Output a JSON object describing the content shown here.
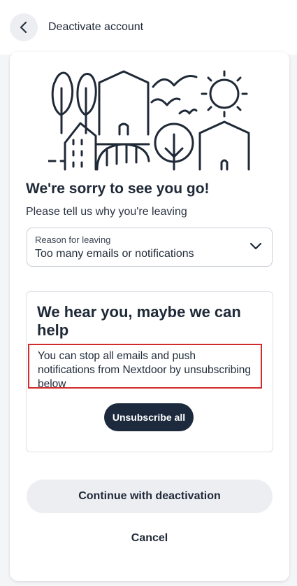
{
  "header": {
    "title": "Deactivate account",
    "back_icon": "chevron-left-icon"
  },
  "illustration": {
    "name": "village-illustration",
    "stroke_color": "#1f2937"
  },
  "main": {
    "headline": "We're sorry to see you go!",
    "prompt": "Please tell us why you're leaving",
    "reason_select": {
      "label": "Reason for leaving",
      "selected": "Too many emails or notifications",
      "icon": "chevron-down-icon"
    },
    "panel": {
      "title": "We hear you, maybe we can help",
      "body": "You can stop all emails and push notifications from Nextdoor by unsubscribing below",
      "unsubscribe_label": "Unsubscribe all"
    },
    "continue_label": "Continue with deactivation",
    "cancel_label": "Cancel"
  },
  "colors": {
    "primary_dark": "#1d2a3e",
    "secondary_bg": "#eceef2",
    "highlight_border": "#d22b2b"
  }
}
